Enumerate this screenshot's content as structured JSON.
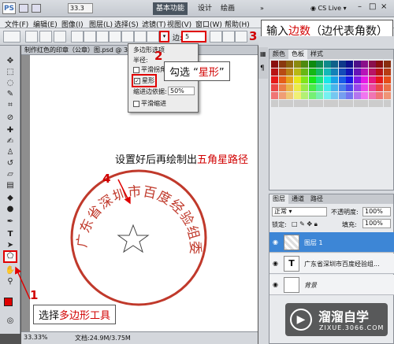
{
  "app": {
    "logo": "PS",
    "zoom_menu": "33.3"
  },
  "menu": [
    "文件(F)",
    "编辑(E)",
    "图像(I)",
    "图层(L)",
    "选择(S)",
    "滤镜(T)",
    "视图(V)",
    "窗口(W)",
    "帮助(H)"
  ],
  "workspace": {
    "basic": "基本功能",
    "design": "设计",
    "paint": "绘画",
    "cslive": "CS Live"
  },
  "options": {
    "sides_label": "边:",
    "sides_value": "5"
  },
  "document": {
    "tab_title": "制作红色的印章（公章）图.psd @ 33.3...",
    "zoom": "33.33%",
    "doc_size": "文档:24.9M/3.75M"
  },
  "popup": {
    "title": "多边形选项",
    "radius_label": "半径:",
    "smooth_corners": "平滑拐角",
    "star": "星形",
    "indent_label": "缩进边依据:",
    "indent_value": "50%",
    "smooth_indent": "平滑缩进"
  },
  "panels": {
    "tabs": [
      "颜色",
      "色板",
      "样式"
    ],
    "layers_tabs": [
      "图层",
      "通道",
      "路径"
    ],
    "blend_mode": "正常",
    "opacity_label": "不透明度:",
    "opacity_value": "100%",
    "lock_label": "锁定:",
    "fill_label": "填充:",
    "fill_value": "100%",
    "layers": [
      {
        "name": "图层 1"
      },
      {
        "name": "广东省深圳市百度经验组..."
      },
      {
        "name": "背景"
      }
    ]
  },
  "stamp": {
    "text": "广东省深圳市百度经验组委员会"
  },
  "annotations": {
    "step3_prefix": "输入",
    "step3_red": "边数",
    "step3_suffix": "（边代表角数）",
    "step2_prefix": "勾选 “",
    "step2_red": "星形",
    "step2_suffix": "”",
    "step4_prefix": "设置好后再绘制出",
    "step4_red": "五角星路径",
    "step1_prefix": "选择",
    "step1_red": "多边形工具",
    "num1": "1",
    "num2": "2",
    "num3": "3",
    "num4": "4"
  },
  "watermark": {
    "title": "溜溜自学",
    "url": "ZIXUE.3066.COM"
  },
  "colors": {
    "annotation_red": "#d10000",
    "stamp_red": "#c0392b",
    "watermark_bg": "#282828"
  }
}
